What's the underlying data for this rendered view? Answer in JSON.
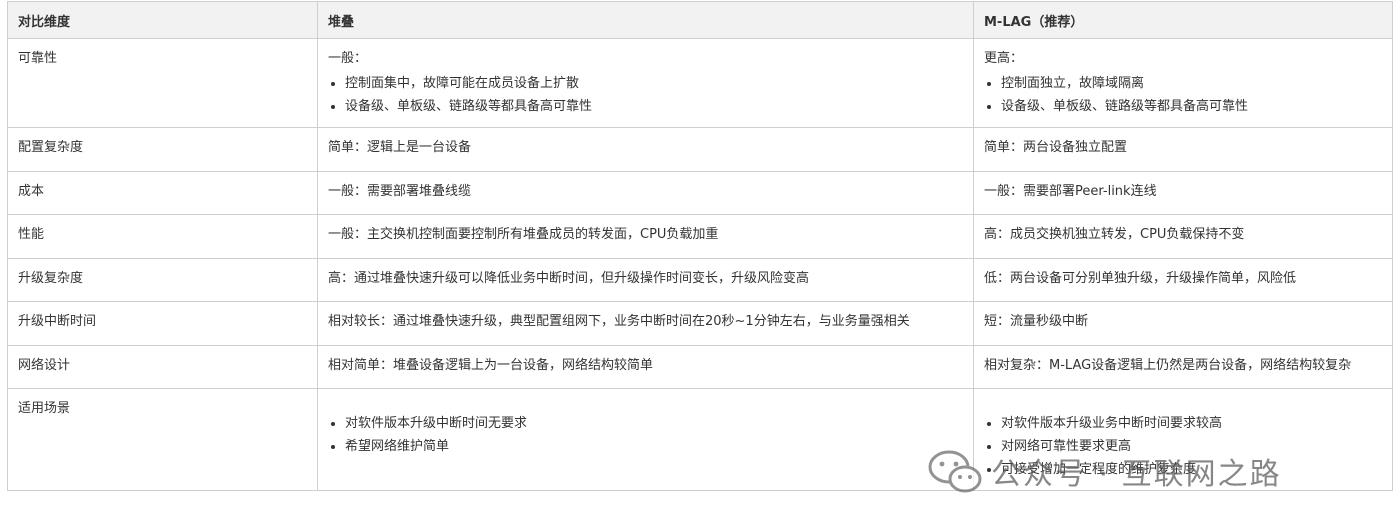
{
  "table": {
    "headers": [
      "对比维度",
      "堆叠",
      "M-LAG（推荐）"
    ],
    "rows": [
      {
        "dim": "可靠性",
        "stack": {
          "intro": "一般：",
          "bullets": [
            "控制面集中，故障可能在成员设备上扩散",
            "设备级、单板级、链路级等都具备高可靠性"
          ]
        },
        "mlag": {
          "intro": "更高：",
          "bullets": [
            "控制面独立，故障域隔离",
            "设备级、单板级、链路级等都具备高可靠性"
          ]
        }
      },
      {
        "dim": "配置复杂度",
        "stack": {
          "text": "简单：逻辑上是一台设备"
        },
        "mlag": {
          "text": "简单：两台设备独立配置"
        }
      },
      {
        "dim": "成本",
        "stack": {
          "text": "一般：需要部署堆叠线缆"
        },
        "mlag": {
          "text": "一般：需要部署Peer-link连线"
        }
      },
      {
        "dim": "性能",
        "stack": {
          "text": "一般：主交换机控制面要控制所有堆叠成员的转发面，CPU负载加重"
        },
        "mlag": {
          "text": "高：成员交换机独立转发，CPU负载保持不变"
        }
      },
      {
        "dim": "升级复杂度",
        "stack": {
          "text": "高：通过堆叠快速升级可以降低业务中断时间，但升级操作时间变长，升级风险变高"
        },
        "mlag": {
          "text": "低：两台设备可分别单独升级，升级操作简单，风险低"
        }
      },
      {
        "dim": "升级中断时间",
        "stack": {
          "text": "相对较长：通过堆叠快速升级，典型配置组网下，业务中断时间在20秒~1分钟左右，与业务量强相关"
        },
        "mlag": {
          "text": "短：流量秒级中断"
        }
      },
      {
        "dim": "网络设计",
        "stack": {
          "text": "相对简单：堆叠设备逻辑上为一台设备，网络结构较简单"
        },
        "mlag": {
          "text": "相对复杂：M-LAG设备逻辑上仍然是两台设备，网络结构较复杂"
        }
      },
      {
        "dim": "适用场景",
        "stack": {
          "bullets": [
            "对软件版本升级中断时间无要求",
            "希望网络维护简单"
          ]
        },
        "mlag": {
          "bullets": [
            "对软件版本升级业务中断时间要求较高",
            "对网络可靠性要求更高",
            "可接受增加一定程度的维护复杂度"
          ]
        }
      }
    ]
  },
  "watermark": {
    "text": "公众号 · 互联网之路",
    "icon": "wechat-icon"
  }
}
